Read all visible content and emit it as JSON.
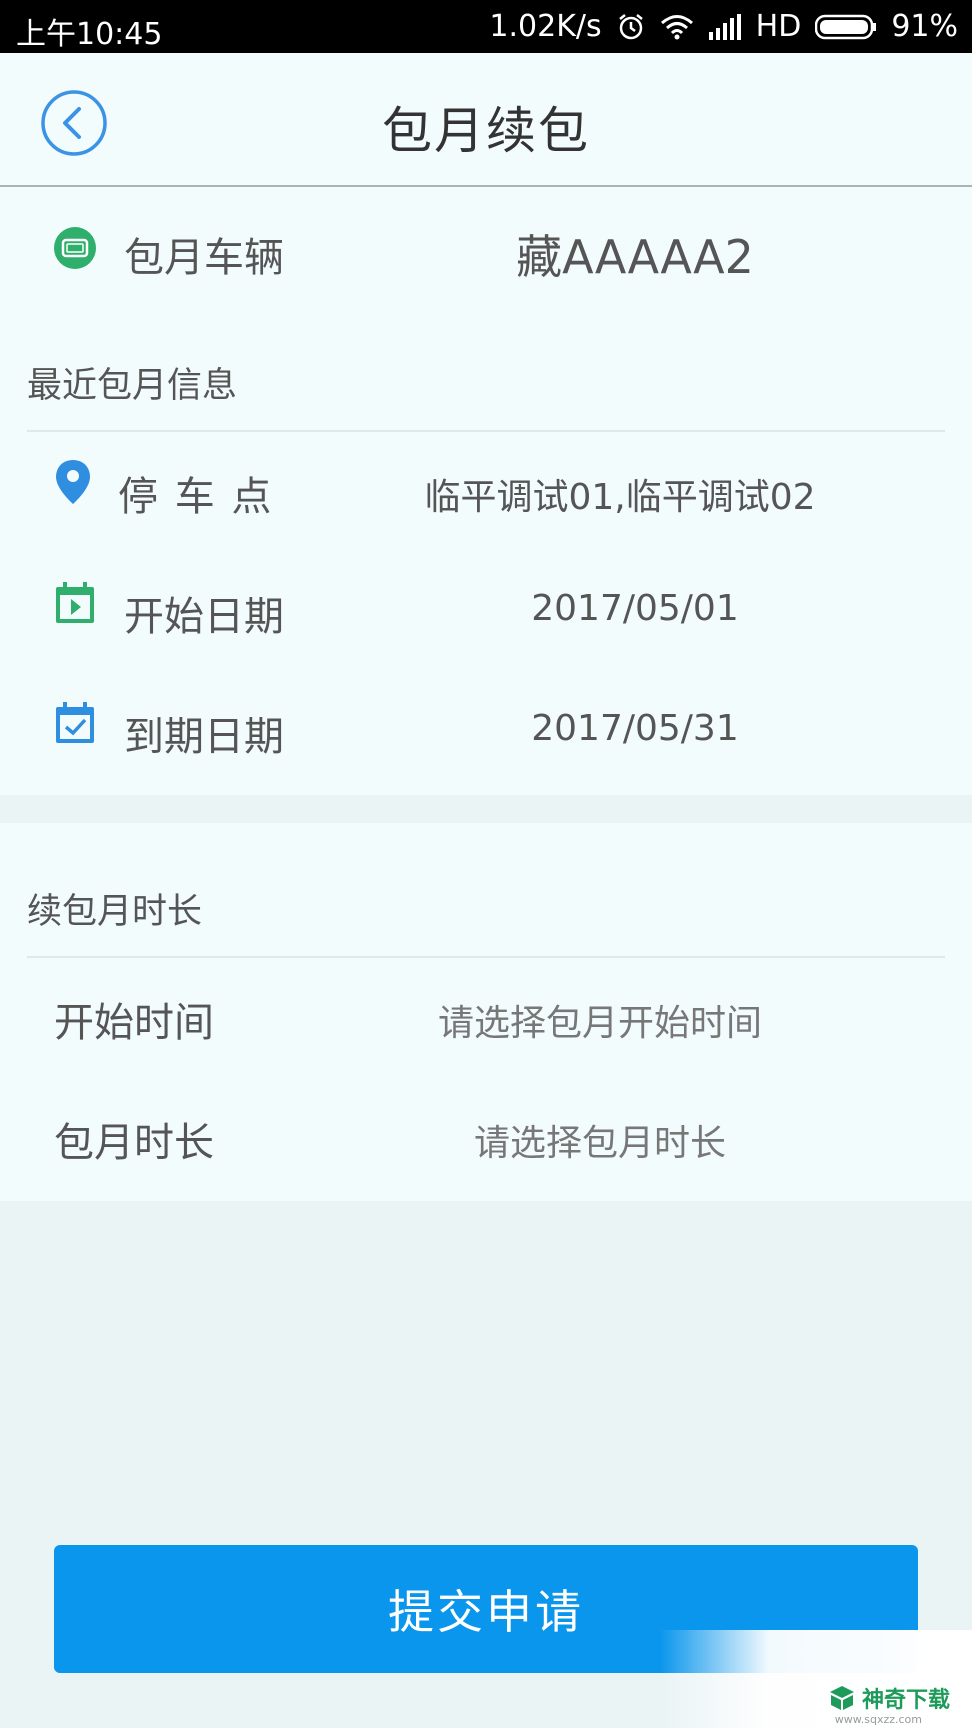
{
  "status_bar": {
    "time": "上午10:45",
    "speed": "1.02K/s",
    "network": "HD",
    "battery": "91%"
  },
  "header": {
    "title": "包月续包",
    "back_icon": "chevron-left-circle-icon"
  },
  "vehicle": {
    "label": "包月车辆",
    "plate": "藏AAAAA2",
    "icon": "license-plate-icon",
    "icon_color": "#2fae6c"
  },
  "recent_info": {
    "section_title": "最近包月信息",
    "rows": [
      {
        "label": "停 车 点",
        "value": "临平调试01,临平调试02",
        "icon": "location-pin-icon",
        "icon_color": "#2f8ee0"
      },
      {
        "label": "开始日期",
        "value": "2017/05/01",
        "icon": "calendar-play-icon",
        "icon_color": "#2fae6c"
      },
      {
        "label": "到期日期",
        "value": "2017/05/31",
        "icon": "calendar-check-icon",
        "icon_color": "#2f8ee0"
      }
    ]
  },
  "renew": {
    "section_title": "续包月时长",
    "rows": [
      {
        "label": "开始时间",
        "placeholder": "请选择包月开始时间"
      },
      {
        "label": "包月时长",
        "placeholder": "请选择包月时长"
      }
    ]
  },
  "submit": {
    "label": "提交申请",
    "color": "#0a96ec"
  },
  "watermark": {
    "brand": "神奇下载",
    "url": "www.sqxzz.com"
  }
}
